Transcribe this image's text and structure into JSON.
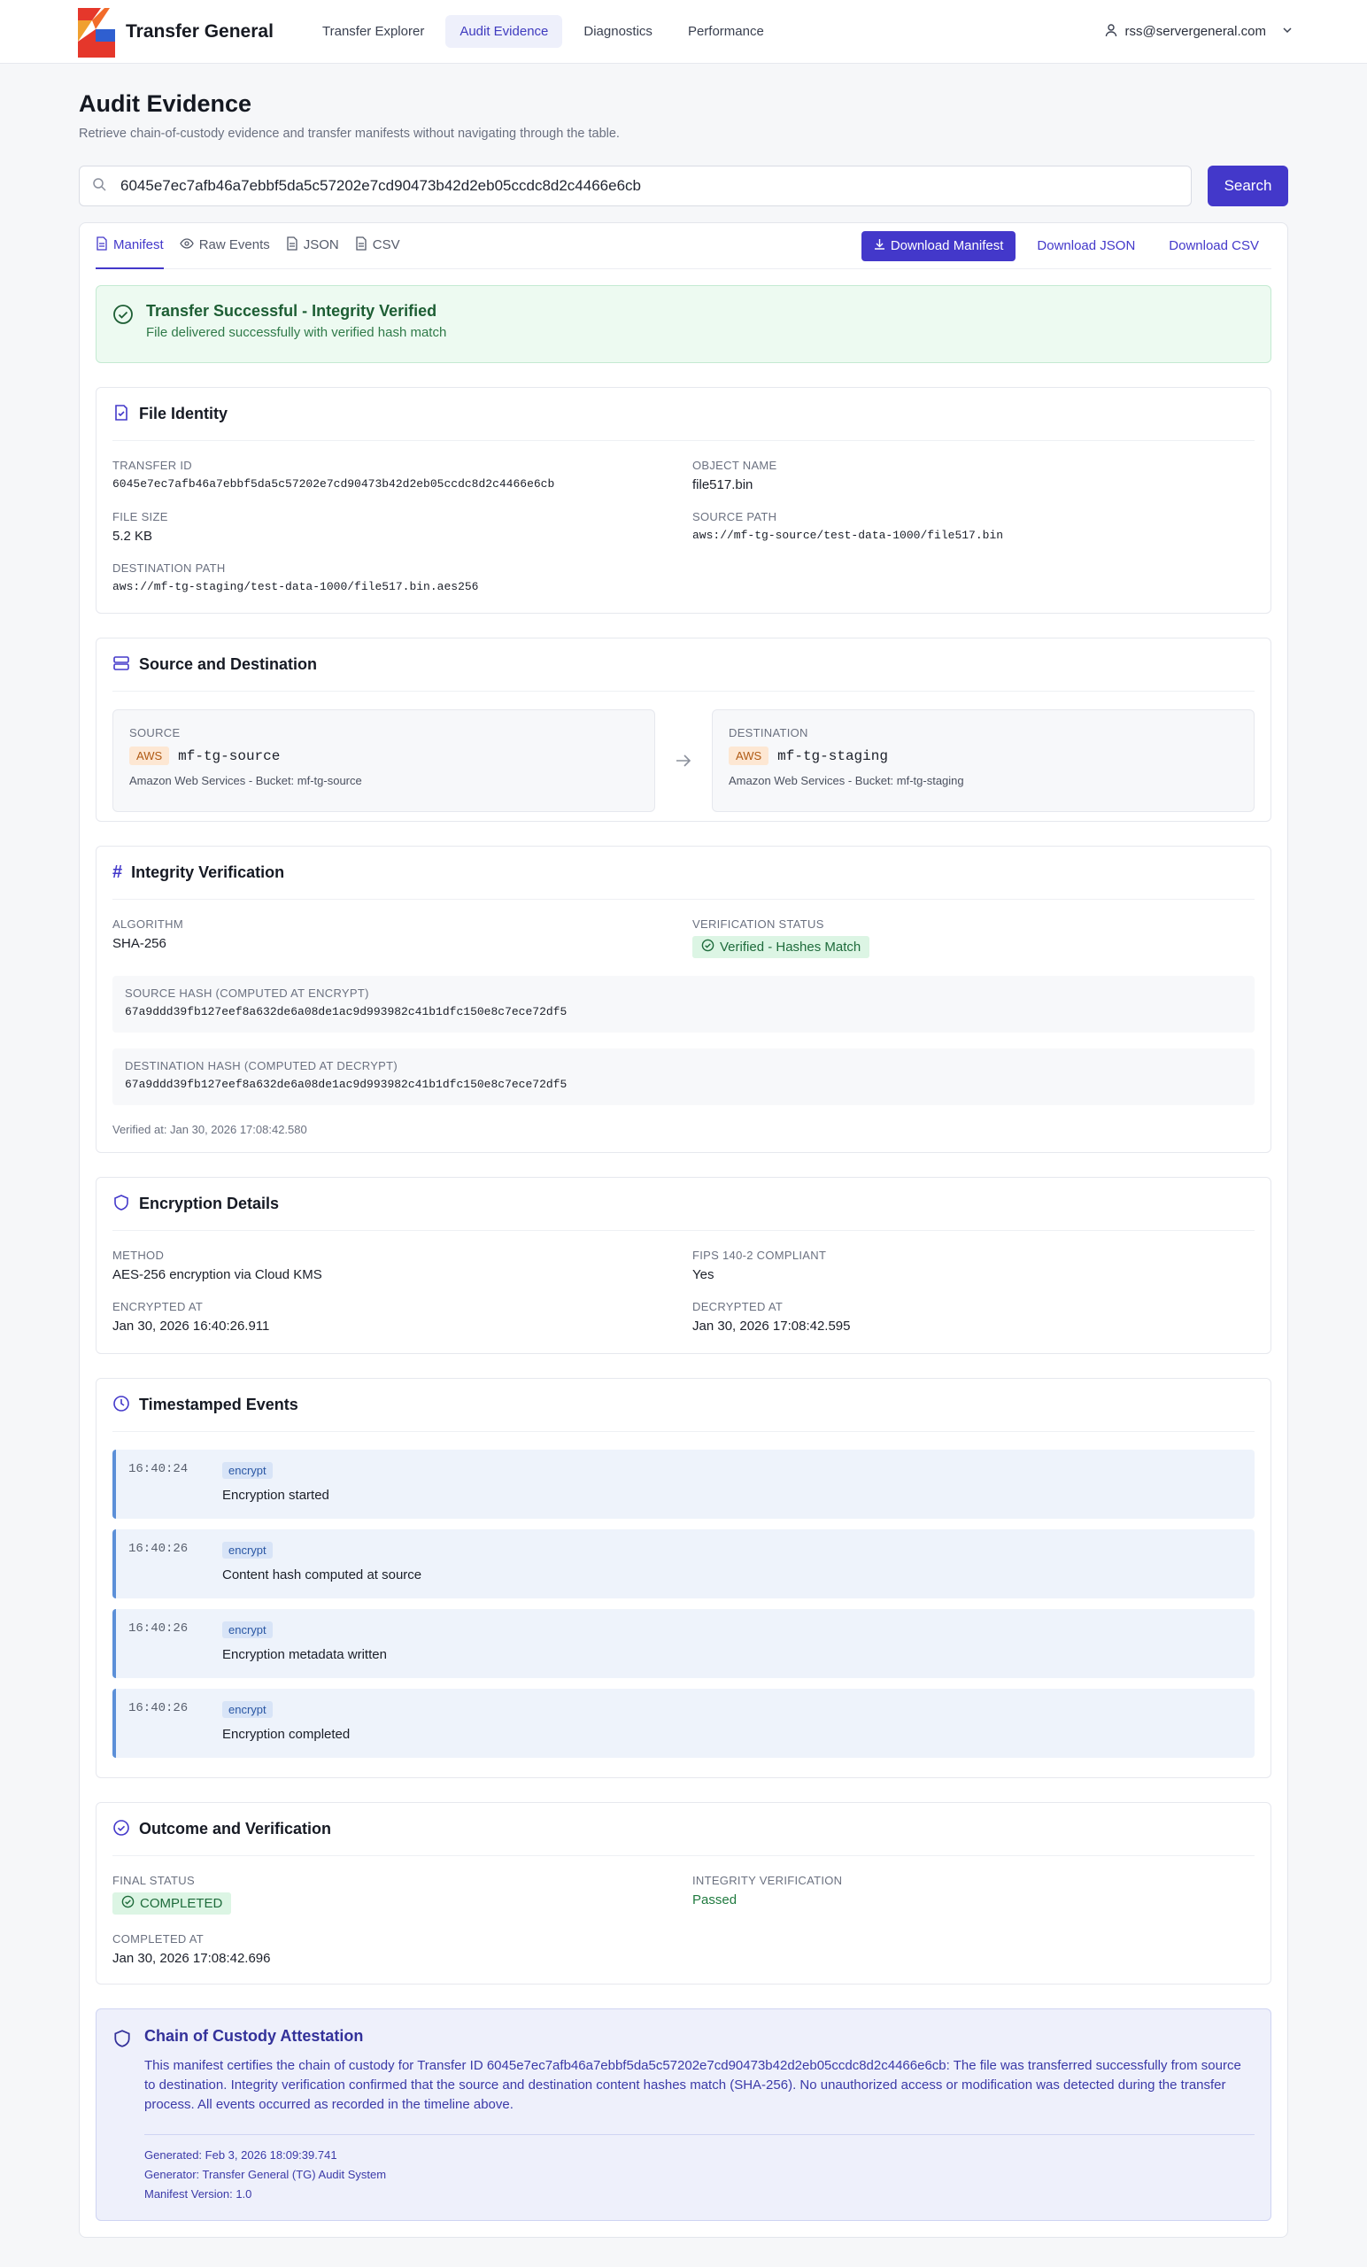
{
  "app": {
    "name": "Transfer General"
  },
  "nav": {
    "links": [
      "Transfer Explorer",
      "Audit Evidence",
      "Diagnostics",
      "Performance"
    ],
    "user_email": "rss@servergeneral.com"
  },
  "page": {
    "title": "Audit Evidence",
    "subtitle": "Retrieve chain-of-custody evidence and transfer manifests without navigating through the table."
  },
  "search": {
    "value": "6045e7ec7afb46a7ebbf5da5c57202e7cd90473b42d2eb05ccdc8d2c4466e6cb",
    "button": "Search"
  },
  "tabs": [
    "Manifest",
    "Raw Events",
    "JSON",
    "CSV"
  ],
  "actions": {
    "download_manifest": "Download Manifest",
    "download_json": "Download JSON",
    "download_csv": "Download CSV"
  },
  "banner": {
    "title": "Transfer Successful - Integrity Verified",
    "subtitle": "File delivered successfully with verified hash match"
  },
  "file_identity": {
    "title": "File Identity",
    "transfer_id_label": "Transfer ID",
    "transfer_id": "6045e7ec7afb46a7ebbf5da5c57202e7cd90473b42d2eb05ccdc8d2c4466e6cb",
    "object_name_label": "Object Name",
    "object_name": "file517.bin",
    "file_size_label": "File Size",
    "file_size": "5.2 KB",
    "source_path_label": "Source Path",
    "source_path": "aws://mf-tg-source/test-data-1000/file517.bin",
    "dest_path_label": "Destination Path",
    "dest_path": "aws://mf-tg-staging/test-data-1000/file517.bin.aes256"
  },
  "source_dest": {
    "title": "Source and Destination",
    "source_label": "Source",
    "source_provider": "AWS",
    "source_bucket": "mf-tg-source",
    "source_desc": "Amazon Web Services - Bucket: mf-tg-source",
    "dest_label": "Destination",
    "dest_provider": "AWS",
    "dest_bucket": "mf-tg-staging",
    "dest_desc": "Amazon Web Services - Bucket: mf-tg-staging"
  },
  "integrity": {
    "title": "Integrity Verification",
    "algorithm_label": "Algorithm",
    "algorithm": "SHA-256",
    "status_label": "Verification Status",
    "status": "Verified - Hashes Match",
    "source_hash_label": "Source Hash (Computed at Encrypt)",
    "source_hash": "67a9ddd39fb127eef8a632de6a08de1ac9d993982c41b1dfc150e8c7ece72df5",
    "dest_hash_label": "Destination Hash (Computed at Decrypt)",
    "dest_hash": "67a9ddd39fb127eef8a632de6a08de1ac9d993982c41b1dfc150e8c7ece72df5",
    "verified_at": "Verified at: Jan 30, 2026 17:08:42.580"
  },
  "encryption": {
    "title": "Encryption Details",
    "method_label": "Method",
    "method": "AES-256 encryption via Cloud KMS",
    "fips_label": "FIPS 140-2 Compliant",
    "fips": "Yes",
    "encrypted_at_label": "Encrypted At",
    "encrypted_at": "Jan 30, 2026 16:40:26.911",
    "decrypted_at_label": "Decrypted At",
    "decrypted_at": "Jan 30, 2026 17:08:42.595"
  },
  "events": {
    "title": "Timestamped Events",
    "items": [
      {
        "time": "16:40:24",
        "tag": "encrypt",
        "text": "Encryption started"
      },
      {
        "time": "16:40:26",
        "tag": "encrypt",
        "text": "Content hash computed at source"
      },
      {
        "time": "16:40:26",
        "tag": "encrypt",
        "text": "Encryption metadata written"
      },
      {
        "time": "16:40:26",
        "tag": "encrypt",
        "text": "Encryption completed"
      }
    ]
  },
  "outcome": {
    "title": "Outcome and Verification",
    "final_status_label": "Final Status",
    "final_status": "COMPLETED",
    "integrity_label": "Integrity Verification",
    "integrity": "Passed",
    "completed_label": "Completed At",
    "completed_at": "Jan 30, 2026 17:08:42.696"
  },
  "attestation": {
    "title": "Chain of Custody Attestation",
    "body": "This manifest certifies the chain of custody for Transfer ID 6045e7ec7afb46a7ebbf5da5c57202e7cd90473b42d2eb05ccdc8d2c4466e6cb: The file was transferred successfully from source to destination. Integrity verification confirmed that the source and destination content hashes match (SHA-256). No unauthorized access or modification was detected during the transfer process. All events occurred as recorded in the timeline above.",
    "generated": "Generated: Feb 3, 2026 18:09:39.741",
    "generator": "Generator: Transfer General (TG) Audit System",
    "version": "Manifest Version: 1.0"
  },
  "colors": {
    "accent": "#4338ca",
    "success": "#1e6b3b",
    "brand_red": "#e5372b",
    "brand_blue": "#2f5fd0"
  }
}
